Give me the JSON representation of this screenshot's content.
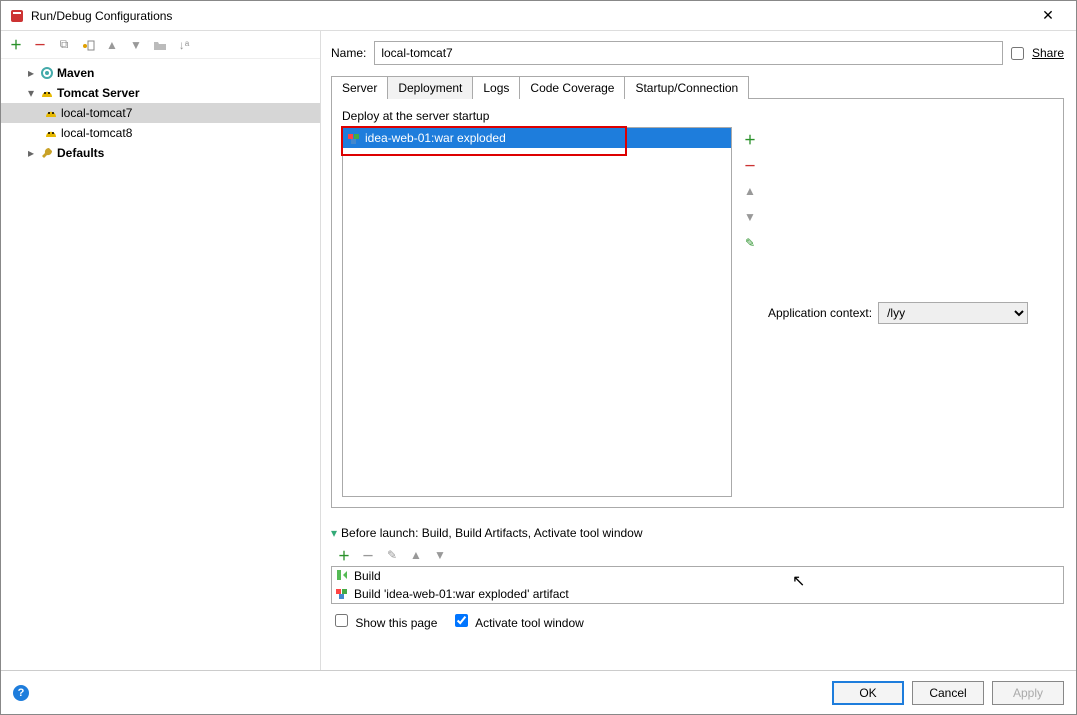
{
  "window": {
    "title": "Run/Debug Configurations"
  },
  "toolbar": {},
  "tree": {
    "maven": "Maven",
    "tomcat": "Tomcat Server",
    "local1": "local-tomcat7",
    "local2": "local-tomcat8",
    "defaults": "Defaults"
  },
  "name": {
    "label": "Name:",
    "value": "local-tomcat7",
    "share": "Share"
  },
  "tabs": {
    "server": "Server",
    "deployment": "Deployment",
    "logs": "Logs",
    "coverage": "Code Coverage",
    "startup": "Startup/Connection"
  },
  "deploy": {
    "label": "Deploy at the server startup",
    "artifact": "idea-web-01:war exploded"
  },
  "context": {
    "label": "Application context:",
    "value": "/lyy"
  },
  "before": {
    "header": "Before launch: Build, Build Artifacts, Activate tool window",
    "row1": "Build",
    "row2": "Build 'idea-web-01:war exploded' artifact"
  },
  "checks": {
    "show": "Show this page",
    "activate": "Activate tool window"
  },
  "footer": {
    "ok": "OK",
    "cancel": "Cancel",
    "apply": "Apply"
  }
}
